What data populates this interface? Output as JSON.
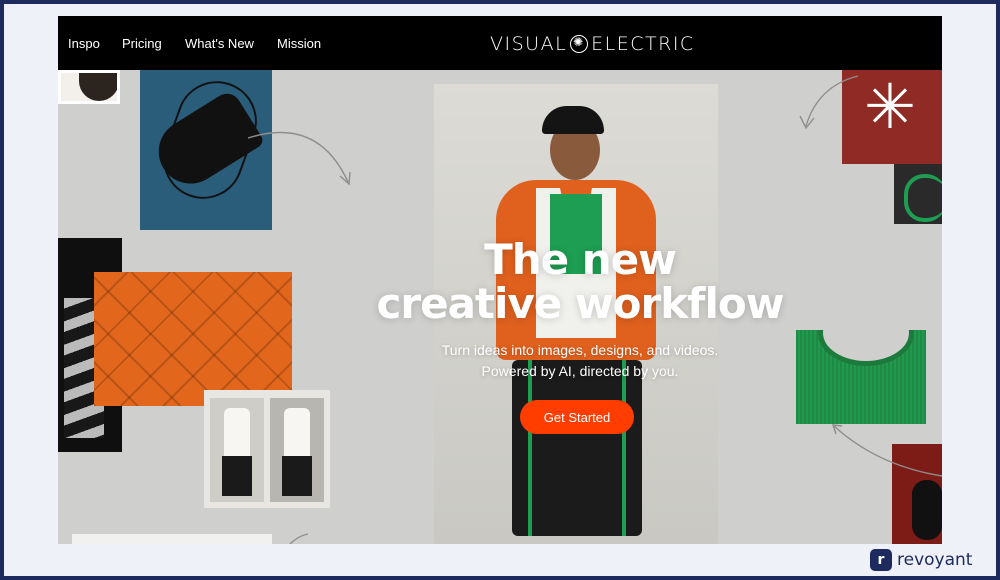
{
  "nav": {
    "links": [
      "Inspo",
      "Pricing",
      "What's New",
      "Mission"
    ],
    "brand": [
      "VISUAL",
      "ELECTRIC"
    ]
  },
  "hero": {
    "headline_line1": "The new",
    "headline_line2": "creative workflow",
    "subcopy_line1": "Turn ideas into images, designs, and videos.",
    "subcopy_line2": "Powered by AI, directed by you.",
    "cta_label": "Get Started"
  },
  "watermark": {
    "logo_letter": "r",
    "text": "revoyant"
  },
  "colors": {
    "nav_background": "#000000",
    "page_background": "#cfd0cd",
    "cta": "#ff3d00",
    "frame": "#1c2a5e"
  }
}
